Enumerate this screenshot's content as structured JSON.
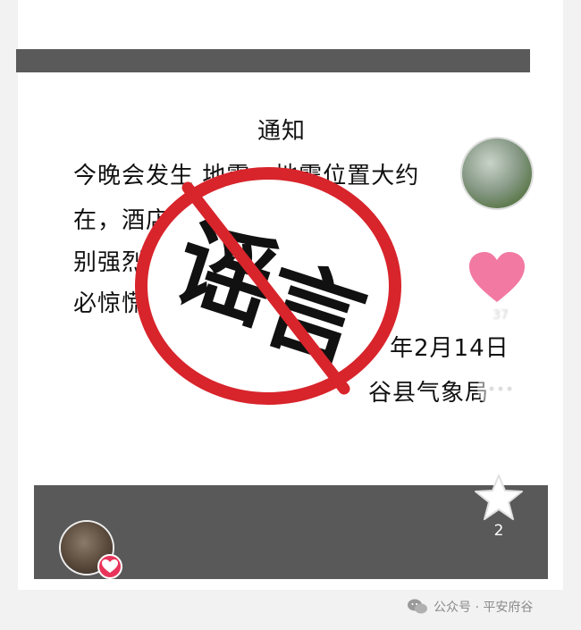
{
  "notice": {
    "title": "通知",
    "line1": "今晚会发生       地震。地震位置大约",
    "line2": "在，酒店                       震感不会特",
    "line3": "别强烈，                         大家不",
    "line4": "必惊慌",
    "date": "年2月14日",
    "org": "谷县气象局"
  },
  "stamp": {
    "text": "谣言"
  },
  "sidebar": {
    "like_count": "37",
    "star_count": "2"
  },
  "watermark": {
    "label": "公众号 · 平安府谷"
  },
  "colors": {
    "stamp_red": "#d8242b",
    "like_pink": "#f06292",
    "bar_gray": "#595959"
  },
  "icons": [
    "heart-icon",
    "comment-icon",
    "star-icon",
    "wechat-icon",
    "plus-icon"
  ]
}
